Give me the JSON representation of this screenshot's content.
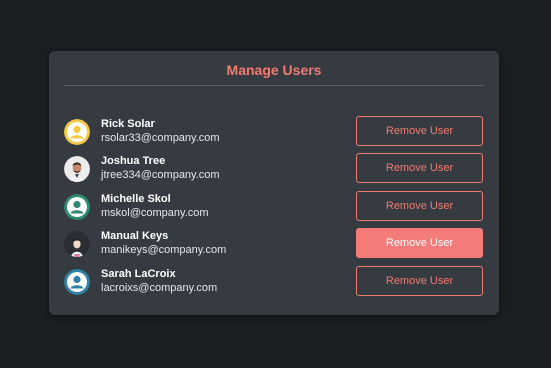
{
  "panel": {
    "title": "Manage Users"
  },
  "users": [
    {
      "name": "Rick Solar",
      "email": "rsolar33@company.com",
      "button": "Remove User",
      "avatar_color": "#f4c842",
      "avatar": "default-avatar-icon"
    },
    {
      "name": "Joshua Tree",
      "email": "jtree334@company.com",
      "button": "Remove User",
      "avatar_color": "#ececec",
      "avatar": "photo-avatar"
    },
    {
      "name": "Michelle Skol",
      "email": "mskol@company.com",
      "button": "Remove User",
      "avatar_color": "#2d8a6e",
      "avatar": "default-avatar-icon"
    },
    {
      "name": "Manual Keys",
      "email": "manikeys@company.com",
      "button": "Remove User",
      "avatar_color": "#2a2d33",
      "avatar": "illustrated-avatar",
      "state": "hover"
    },
    {
      "name": "Sarah LaCroix",
      "email": "lacroixs@company.com",
      "button": "Remove User",
      "avatar_color": "#2f7fa6",
      "avatar": "default-avatar-icon"
    }
  ],
  "colors": {
    "accent": "#f07c70",
    "button_active_bg": "#f47c78",
    "panel_bg": "#363b42",
    "page_bg": "#1b1e22"
  }
}
